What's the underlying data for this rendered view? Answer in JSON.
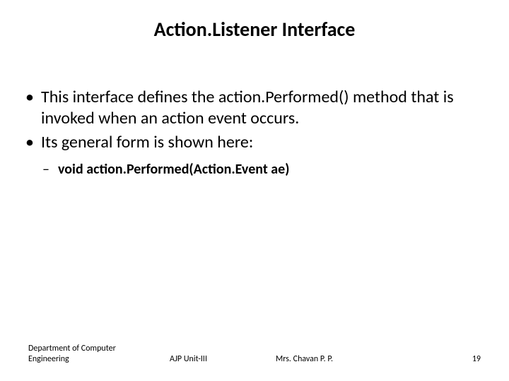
{
  "title": "Action.Listener Interface",
  "bullets": [
    "This interface defines the action.Performed() method that is invoked when an action event occurs.",
    "Its general form is shown here:"
  ],
  "sub_bullet": "void action.Performed(Action.Event ae)",
  "footer": {
    "dept_line1": "Department of Computer",
    "dept_line2": "Engineering",
    "course": "AJP Unit-III",
    "author": "Mrs. Chavan P. P.",
    "page": "19"
  }
}
